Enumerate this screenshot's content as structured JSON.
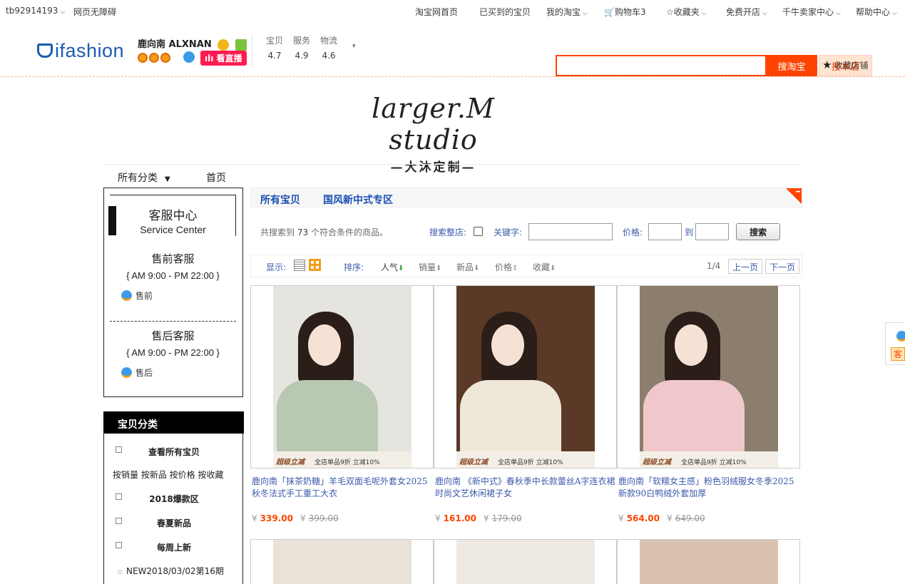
{
  "topbar": {
    "username": "tb92914193",
    "accessibility": "网页无障碍",
    "home": "淘宝网首页",
    "bought": "已买到的宝贝",
    "my_taobao": "我的淘宝",
    "cart": "购物车3",
    "favorites": "收藏夹",
    "open_shop": "免费开店",
    "seller_center": "千牛卖家中心",
    "help": "帮助中心"
  },
  "shop": {
    "logo": "ifashion",
    "name": "鹿向南 ALXNAN",
    "live_label": "看直播",
    "scores": [
      {
        "label": "宝贝",
        "value": "4.7"
      },
      {
        "label": "服务",
        "value": "4.9"
      },
      {
        "label": "物流",
        "value": "4.6"
      }
    ],
    "search_taobao": "搜淘宝",
    "search_shop": "搜本店",
    "favorite_shop": "收藏店铺"
  },
  "brand": {
    "script": "larger.M studio",
    "cn": "—大沐定制—"
  },
  "shopnav": {
    "all_categories": "所有分类",
    "home": "首页"
  },
  "service": {
    "title": "客服中心",
    "subtitle": "Service Center",
    "presale_title": "售前客服",
    "presale_hours": "{ AM 9:00 - PM 22:00 }",
    "presale_link": "售前",
    "aftersale_title": "售后客服",
    "aftersale_hours": "{ AM 9:00 - PM 22:00 }",
    "aftersale_link": "售后"
  },
  "categories": {
    "header": "宝贝分类",
    "view_all": "查看所有宝贝",
    "sorts": "按销量 按新品 按价格 按收藏",
    "items": [
      "2018爆款区",
      "春夏新品",
      "每周上新"
    ],
    "sub_item": "NEW2018/03/02第16期"
  },
  "crumbs": {
    "all": "所有宝贝",
    "section": "国风新中式专区"
  },
  "filter": {
    "result_prefix": "共搜索到",
    "count": "73",
    "result_suffix": "个符合条件的商品。",
    "search_whole": "搜索整店:",
    "keyword": "关键字:",
    "price": "价格:",
    "to": "到",
    "search_btn": "搜索"
  },
  "sortbar": {
    "display": "显示:",
    "sort": "排序:",
    "popularity": "人气",
    "sales": "销量",
    "newest": "新品",
    "price": "价格",
    "collect": "收藏",
    "page": "1/4",
    "prev": "上一页",
    "next": "下一页"
  },
  "products": [
    {
      "title": "鹿向南「抹茶奶糖」羊毛双面毛呢外套女2025秋冬法式手工重工大衣",
      "price": "339.00",
      "original_price": "399.00",
      "coat_color": "#b8c8b2",
      "bg_color": "#e6e4df"
    },
    {
      "title": "鹿向南 《新中式》春秋季中长款蕾丝A字连衣裙时尚文艺休闲裙子女",
      "price": "161.00",
      "original_price": "179.00",
      "coat_color": "#efe8da",
      "bg_color": "#5a3a26"
    },
    {
      "title": "鹿向南「软糯女主感」粉色羽绒服女冬季2025新款90白鸭绒外套加厚",
      "price": "564.00",
      "original_price": "649.00",
      "coat_color": "#f0c8cc",
      "bg_color": "#8b7e6c"
    }
  ],
  "promo": {
    "tag": "超级立减",
    "text": "全店单品9折 立减10%"
  },
  "currency": "¥",
  "side_float_label": "客"
}
